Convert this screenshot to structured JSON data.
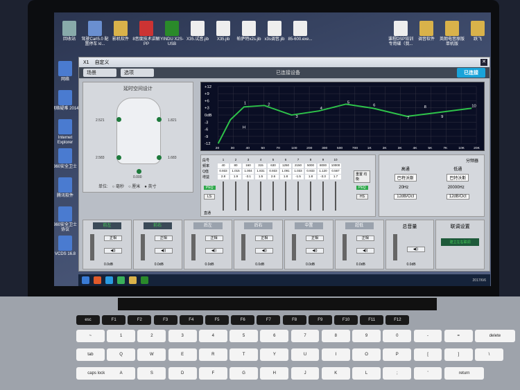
{
  "desktop_icons": [
    {
      "label": "回收站",
      "color": "#8aa"
    },
    {
      "label": "驾驶Carl5.0 配置停车 kl...",
      "color": "#6a8fd0"
    },
    {
      "label": "影机软件",
      "color": "#d9b24a"
    },
    {
      "label": "8音度技术讲解PP",
      "color": "#c33"
    },
    {
      "label": "YINDU X2S-USB",
      "color": "#2a8a2a"
    },
    {
      "label": "X35.试音.jib",
      "color": "#eee"
    },
    {
      "label": "X35.jib",
      "color": "#eee"
    },
    {
      "label": "帕萨特x2s.jib",
      "color": "#eee"
    },
    {
      "label": "x3s调音.jib",
      "color": "#eee"
    },
    {
      "label": "85-600.exe...",
      "color": "#eee"
    },
    {
      "label": "课程DSP培训 专用碟（我...",
      "color": "#eee"
    },
    {
      "label": "调音软件",
      "color": "#d9b24a"
    },
    {
      "label": "英朗电音原版 单机版",
      "color": "#d9b24a"
    },
    {
      "label": "跃飞",
      "color": "#d9b24a"
    }
  ],
  "left_icons": [
    "网络",
    "网络疑难 2014",
    "Internet Explorer",
    "360安全卫士",
    "腾讯软件",
    "360安全卫士 协议",
    "VCDS 16.8"
  ],
  "app": {
    "title": "X1",
    "subtitle": "自定义",
    "scene_label": "场景",
    "options_label": "选项",
    "status": "已连接设备",
    "connect_button": "已连接"
  },
  "car_panel": {
    "title": "延时空间设计",
    "distances": [
      "2.521",
      "1.821",
      "2.583",
      "1.683",
      "0.000"
    ],
    "unit_label": "单位:",
    "units": [
      "毫秒",
      "厘米",
      "英寸"
    ],
    "selected_unit": "英寸"
  },
  "eq_graph": {
    "y_labels": [
      "+12",
      "+9",
      "+6",
      "+3",
      "0dB",
      "-3",
      "-6",
      "-9",
      "-12"
    ],
    "x_labels": [
      "20",
      "30",
      "40",
      "50",
      "70",
      "100",
      "200",
      "300",
      "500",
      "700",
      "1K",
      "2K",
      "3K",
      "4K",
      "5K",
      "7K",
      "10K",
      "20K"
    ],
    "point_labels": [
      "1",
      "2",
      "3",
      "4",
      "5",
      "6",
      "7",
      "8",
      "9",
      "10",
      "H"
    ],
    "curve_color": "#2ec44a"
  },
  "eq_controls": {
    "row_labels": [
      "段号",
      "频率",
      "Q值",
      "增益"
    ],
    "bands": [
      "1",
      "2",
      "3",
      "4",
      "5",
      "6",
      "7",
      "8",
      "9",
      "10"
    ],
    "freq": [
      "40",
      "80",
      "160",
      "315",
      "630",
      "1250",
      "2150",
      "5000",
      "8000",
      "10000"
    ],
    "q": [
      "0.933",
      "1.015",
      "1.004",
      "1.831",
      "0.933",
      "1.091",
      "1.033",
      "0.933",
      "1.120",
      "0.567"
    ],
    "gain": [
      "2.8",
      "1.9",
      "-3.1",
      "1.5",
      "2.6",
      "1.8",
      "-1.5",
      "1.8",
      "-3.3",
      "1.7"
    ],
    "left_buttons": [
      "PEQ",
      "LS",
      "直通"
    ],
    "right_buttons": [
      "PEQ",
      "HS",
      "重置 均衡"
    ],
    "reset": "直通"
  },
  "crossover": {
    "title": "分频器",
    "hp_label": "高通",
    "lp_label": "低通",
    "type_label": "类型",
    "type_value": "巴特沃斯",
    "freq_label": "频率",
    "hp_freq": "20Hz",
    "lp_freq": "20000Hz",
    "slope_label": "斜率",
    "slope_value": "12dB/Oct"
  },
  "channels": [
    {
      "name": "前左",
      "active": true,
      "db": "0.0dB",
      "phase": "正相"
    },
    {
      "name": "前右",
      "active": true,
      "db": "0.0dB",
      "phase": "正相"
    },
    {
      "name": "后左",
      "active": false,
      "db": "0.0dB",
      "phase": "正相"
    },
    {
      "name": "后右",
      "active": false,
      "db": "0.0dB",
      "phase": "正相"
    },
    {
      "name": "中置",
      "active": false,
      "db": "0.0dB",
      "phase": "正相"
    },
    {
      "name": "超低",
      "active": false,
      "db": "0.0dB",
      "phase": "正相"
    }
  ],
  "master": {
    "label": "总音量",
    "db": "0.0dB"
  },
  "link": {
    "label": "联调设置",
    "button": "建立左右联调"
  },
  "taskbar": {
    "date": "2017/6/6"
  },
  "keyboard": {
    "row1": [
      "esc",
      "F1",
      "F2",
      "F3",
      "F4",
      "F5",
      "F6",
      "F7",
      "F8",
      "F9",
      "F10",
      "F11",
      "F12"
    ],
    "row2": [
      "~",
      "1",
      "2",
      "3",
      "4",
      "5",
      "6",
      "7",
      "8",
      "9",
      "0",
      "-",
      "=",
      "delete"
    ],
    "row3": [
      "tab",
      "Q",
      "W",
      "E",
      "R",
      "T",
      "Y",
      "U",
      "I",
      "O",
      "P",
      "[",
      "]",
      "\\"
    ],
    "row4": [
      "caps lock",
      "A",
      "S",
      "D",
      "F",
      "G",
      "H",
      "J",
      "K",
      "L",
      ";",
      "'",
      "return"
    ]
  }
}
